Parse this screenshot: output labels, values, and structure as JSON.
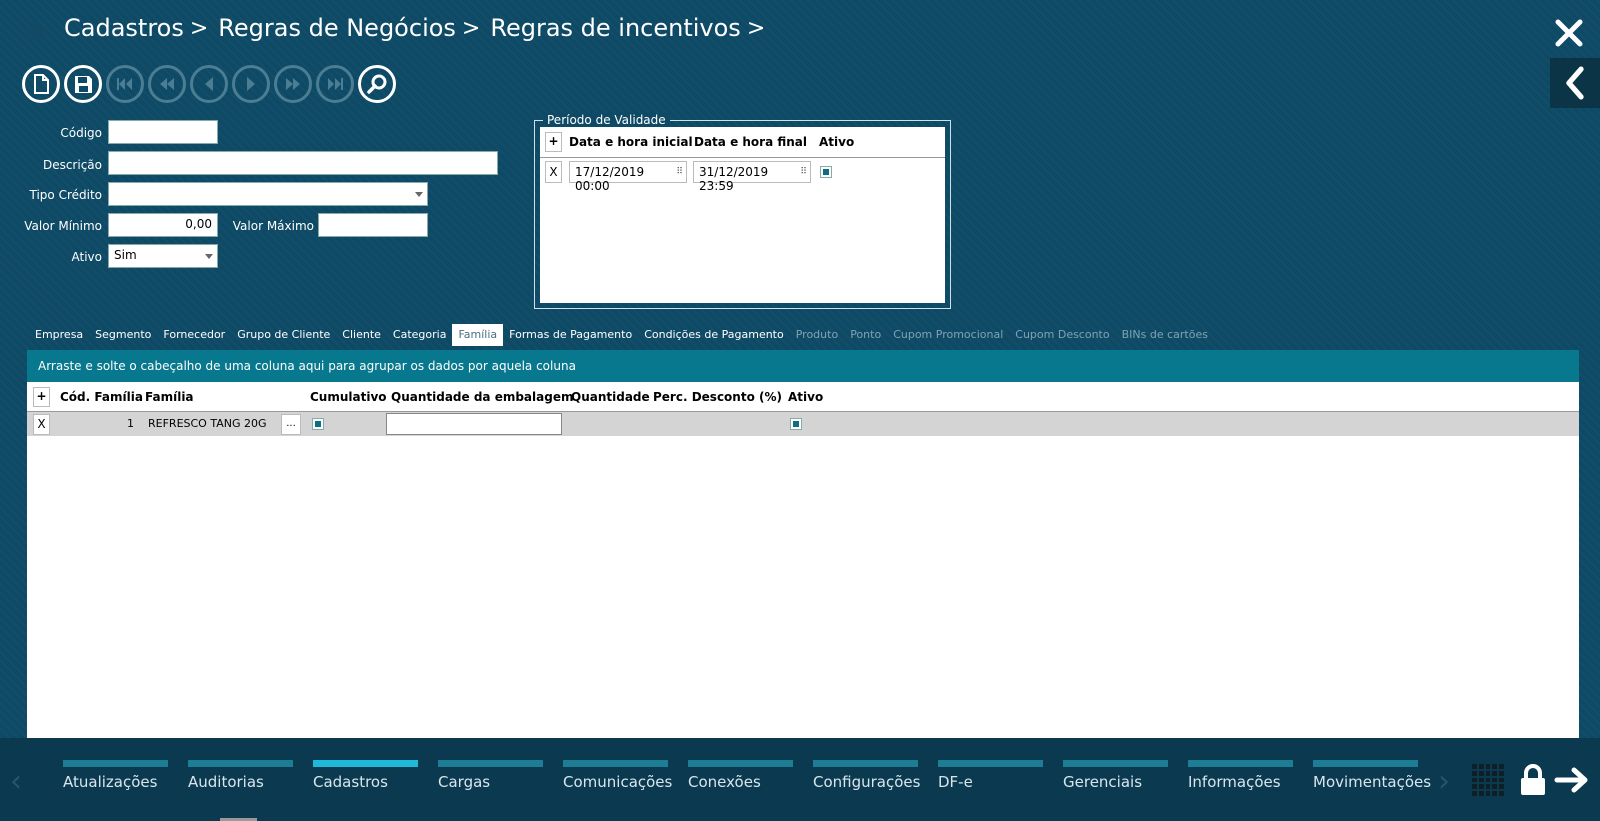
{
  "header": {
    "breadcrumb": [
      "Cadastros",
      "Regras de Negócios",
      "Regras de incentivos"
    ],
    "separator": ">"
  },
  "toolbar": {
    "buttons": [
      {
        "name": "new-document-icon",
        "enabled": true
      },
      {
        "name": "save-icon",
        "enabled": true
      },
      {
        "name": "first-record-icon",
        "enabled": false
      },
      {
        "name": "rewind-icon",
        "enabled": false
      },
      {
        "name": "previous-icon",
        "enabled": false
      },
      {
        "name": "next-icon",
        "enabled": false
      },
      {
        "name": "fast-forward-icon",
        "enabled": false
      },
      {
        "name": "last-record-icon",
        "enabled": false
      },
      {
        "name": "search-icon",
        "enabled": true
      }
    ]
  },
  "form": {
    "codigo_label": "Código",
    "codigo_value": "",
    "descricao_label": "Descrição",
    "descricao_value": "",
    "tipo_credito_label": "Tipo Crédito",
    "tipo_credito_value": "",
    "valor_minimo_label": "Valor Mínimo",
    "valor_minimo_value": "0,00",
    "valor_maximo_label": "Valor Máximo",
    "valor_maximo_value": "",
    "ativo_label": "Ativo",
    "ativo_value": "Sim"
  },
  "validity": {
    "legend": "Período de Validade",
    "add": "+",
    "col_start": "Data e hora inicial",
    "col_end": "Data e hora final",
    "col_active": "Ativo",
    "rows": [
      {
        "remove": "X",
        "start": "17/12/2019 00:00",
        "end": "31/12/2019 23:59",
        "active": true
      }
    ]
  },
  "tabs": [
    {
      "label": "Empresa",
      "state": "normal"
    },
    {
      "label": "Segmento",
      "state": "normal"
    },
    {
      "label": "Fornecedor",
      "state": "normal"
    },
    {
      "label": "Grupo de Cliente",
      "state": "normal"
    },
    {
      "label": "Cliente",
      "state": "normal"
    },
    {
      "label": "Categoria",
      "state": "normal"
    },
    {
      "label": "Família",
      "state": "active"
    },
    {
      "label": "Formas de Pagamento",
      "state": "normal"
    },
    {
      "label": "Condições de Pagamento",
      "state": "normal"
    },
    {
      "label": "Produto",
      "state": "disabled"
    },
    {
      "label": "Ponto",
      "state": "disabled"
    },
    {
      "label": "Cupom Promocional",
      "state": "disabled"
    },
    {
      "label": "Cupom Desconto",
      "state": "disabled"
    },
    {
      "label": "BINs de cartões",
      "state": "disabled"
    }
  ],
  "grid": {
    "group_hint": "Arraste e solte o cabeçalho de uma coluna aqui para agrupar os dados por aquela coluna",
    "add": "+",
    "columns": [
      "Cód. Família",
      "Família",
      "Cumulativo",
      "Quantidade da embalagem",
      "Quantidade",
      "Perc. Desconto (%)",
      "Ativo"
    ],
    "rows": [
      {
        "remove": "X",
        "codigo": "1",
        "familia": "REFRESCO TANG 20G",
        "ellipsis": "...",
        "cumulativo": true,
        "qtd_embalagem": "",
        "quantidade": "",
        "perc_desconto": "",
        "ativo": true
      }
    ]
  },
  "bottom_nav": {
    "modules": [
      {
        "label": "Atualizações",
        "active": false
      },
      {
        "label": "Auditorias",
        "active": false
      },
      {
        "label": "Cadastros",
        "active": true
      },
      {
        "label": "Cargas",
        "active": false
      },
      {
        "label": "Comunicações",
        "active": false
      },
      {
        "label": "Conexões",
        "active": false
      },
      {
        "label": "Configurações",
        "active": false
      },
      {
        "label": "DF-e",
        "active": false
      },
      {
        "label": "Gerenciais",
        "active": false
      },
      {
        "label": "Informações",
        "active": false
      },
      {
        "label": "Movimentações",
        "active": false
      }
    ]
  },
  "colors": {
    "background": "#0e4a66",
    "accent": "#07788d",
    "active_module": "#1fb8d8"
  }
}
